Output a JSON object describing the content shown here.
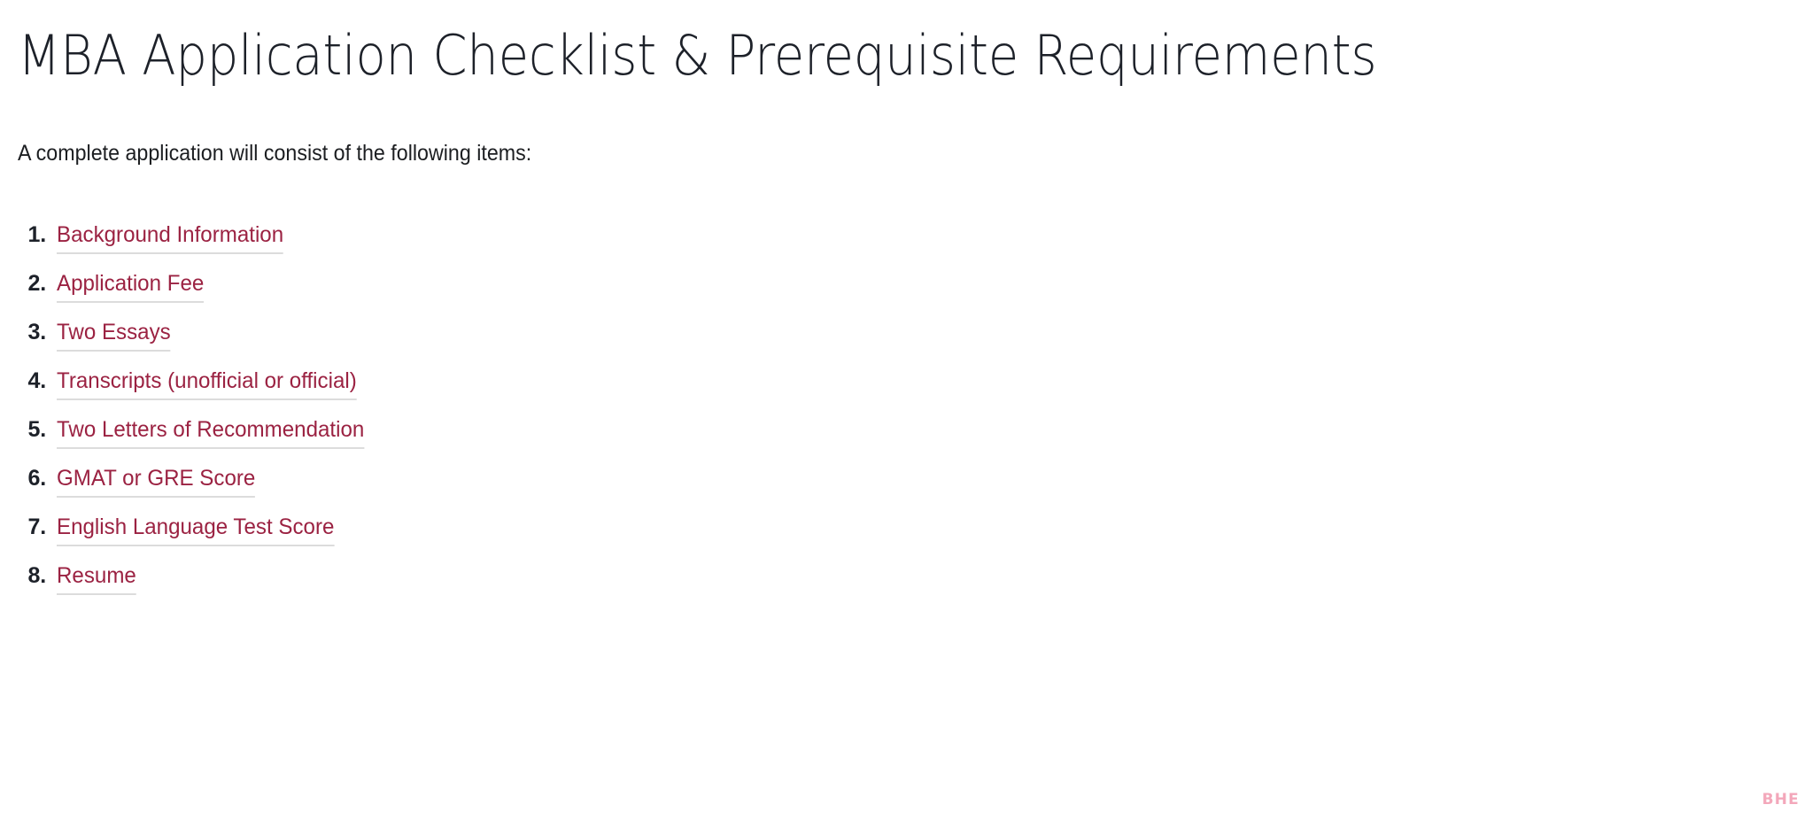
{
  "page": {
    "title": "MBA Application Checklist & Prerequisite Requirements",
    "intro": "A complete application will consist of the following items:",
    "background_color": "#ffffff",
    "heading_color": "#1d2129",
    "link_color": "#9b2242",
    "link_underline_color": "#dcdcdc"
  },
  "checklist": {
    "items": [
      {
        "number": "1.",
        "label": "Background Information"
      },
      {
        "number": "2.",
        "label": "Application Fee"
      },
      {
        "number": "3.",
        "label": "Two Essays"
      },
      {
        "number": "4.",
        "label": "Transcripts (unofficial or official)"
      },
      {
        "number": "5.",
        "label": "Two Letters of Recommendation"
      },
      {
        "number": "6.",
        "label": "GMAT or GRE Score"
      },
      {
        "number": "7.",
        "label": "English Language Test Score"
      },
      {
        "number": "8.",
        "label": "Resume"
      }
    ]
  },
  "watermark": {
    "text": "BHE",
    "color": "#f3a7ba"
  }
}
